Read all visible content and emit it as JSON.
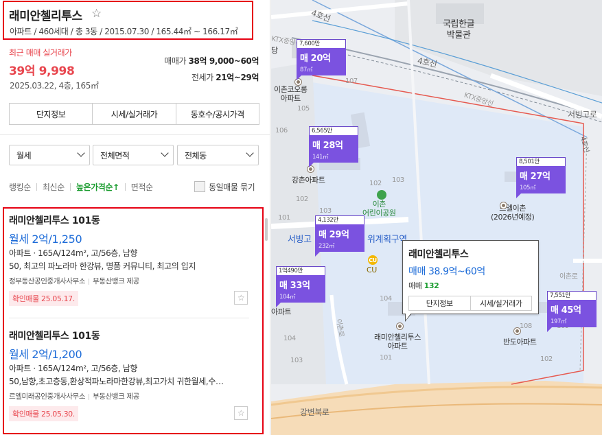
{
  "complex": {
    "name": "래미안첼리투스",
    "star": "☆",
    "summary": "아파트 / 460세대 / 총 3동 / 2015.07.30 / 165.44㎡ ~ 166.17㎡"
  },
  "recent_trade": {
    "label": "최근 매매 실거래가",
    "price": "39억 9,998",
    "detail": "2025.03.22, 4층, 165㎡"
  },
  "price_range": {
    "sale_label": "매매가",
    "sale_value": "38억 9,000~60억",
    "jeonse_label": "전세가",
    "jeonse_value": "21억~29억"
  },
  "tabs": [
    {
      "label": "단지정보"
    },
    {
      "label": "시세/실거래가"
    },
    {
      "label": "동호수/공시가격"
    }
  ],
  "filters": {
    "type": "월세",
    "area": "전체면적",
    "dong": "전체동"
  },
  "sort": {
    "items": [
      "랭킹순",
      "최신순",
      "높은가격순↑",
      "면적순"
    ],
    "active_index": 2,
    "same_listing_label": "동일매물 묶기",
    "same_listing_checked": false
  },
  "listings": [
    {
      "name": "래미안첼리투스 101동",
      "price": "월세 2억/1,250",
      "spec": "아파트 · 165A/124m², 고/56층, 남향",
      "desc": "50, 최고의 파노라마 한강뷰, 명품 커뮤니티, 최고의 입지",
      "agent": "정부동산공인중개사사무소",
      "provider": "부동산뱅크 제공",
      "confirmed": "확인매물 25.05.17."
    },
    {
      "name": "래미안첼리투스 101동",
      "price": "월세 2억/1,200",
      "spec": "아파트 · 165A/124m², 고/56층, 남향",
      "desc": "50,남향,초고층동,환상적파노라마한강뷰,최고가치 귀한월세,수…",
      "agent": "르엘미래공인중개사사무소",
      "provider": "부동산뱅크 제공",
      "confirmed": "확인매물 25.05.30."
    }
  ],
  "map": {
    "labels": {
      "museum": "국립한글\n박물관",
      "ichon_kolon": "이촌코오롱\n아파트",
      "gangchon": "강촌아파트",
      "reel_ichon": "르엘이촌\n(2026년예정)",
      "ichon_park": "이촌\n어린이공원",
      "seobinggo": "서빙고",
      "wigye": "위계획구역",
      "cu": "CU",
      "raemian_pin": "래미안첼리투스\n아파트",
      "bando": "반도아파트",
      "gangbyeon": "강변북로",
      "seobinggo_ro": "서빙고로",
      "ichon_ro": "이촌로",
      "ichon_ro2": "이촌로",
      "line4": "4호선",
      "line4b": "4호선",
      "ktx1": "KTX중앙선",
      "ktx2": "KTX중앙선",
      "line4c": "4호선",
      "apt_short": "아파트",
      "dang": "당"
    },
    "numbers": [
      "105",
      "107",
      "106",
      "104",
      "103",
      "102",
      "101",
      "105",
      "106",
      "102",
      "103",
      "104",
      "101",
      "108",
      "109",
      "102",
      "103",
      "104",
      "101"
    ],
    "markers": [
      {
        "top": "7,600만",
        "price": "매 20억",
        "area": "87㎡"
      },
      {
        "top": "6,565만",
        "price": "매 28억",
        "area": "141㎡"
      },
      {
        "top": "8,501만",
        "price": "매 27억",
        "area": "105㎡"
      },
      {
        "top": "4,132만",
        "price": "매 29억",
        "area": "232㎡"
      },
      {
        "top": "1억490만",
        "price": "매 33억",
        "area": "104㎡"
      },
      {
        "top": "7,551만",
        "price": "매 45억",
        "area": "197㎡"
      }
    ],
    "popup": {
      "title": "래미안첼리투스",
      "sale": "매매 38.9억~60억",
      "count_label": "매매",
      "count": "132",
      "btn_info": "단지정보",
      "btn_price": "시세/실거래가"
    }
  },
  "colors": {
    "accent_red": "#e8464e",
    "price_blue": "#1c6bd8",
    "marker_purple": "#7b52e0",
    "active_green": "#1a9c2f",
    "highlight_border": "#e60012"
  }
}
